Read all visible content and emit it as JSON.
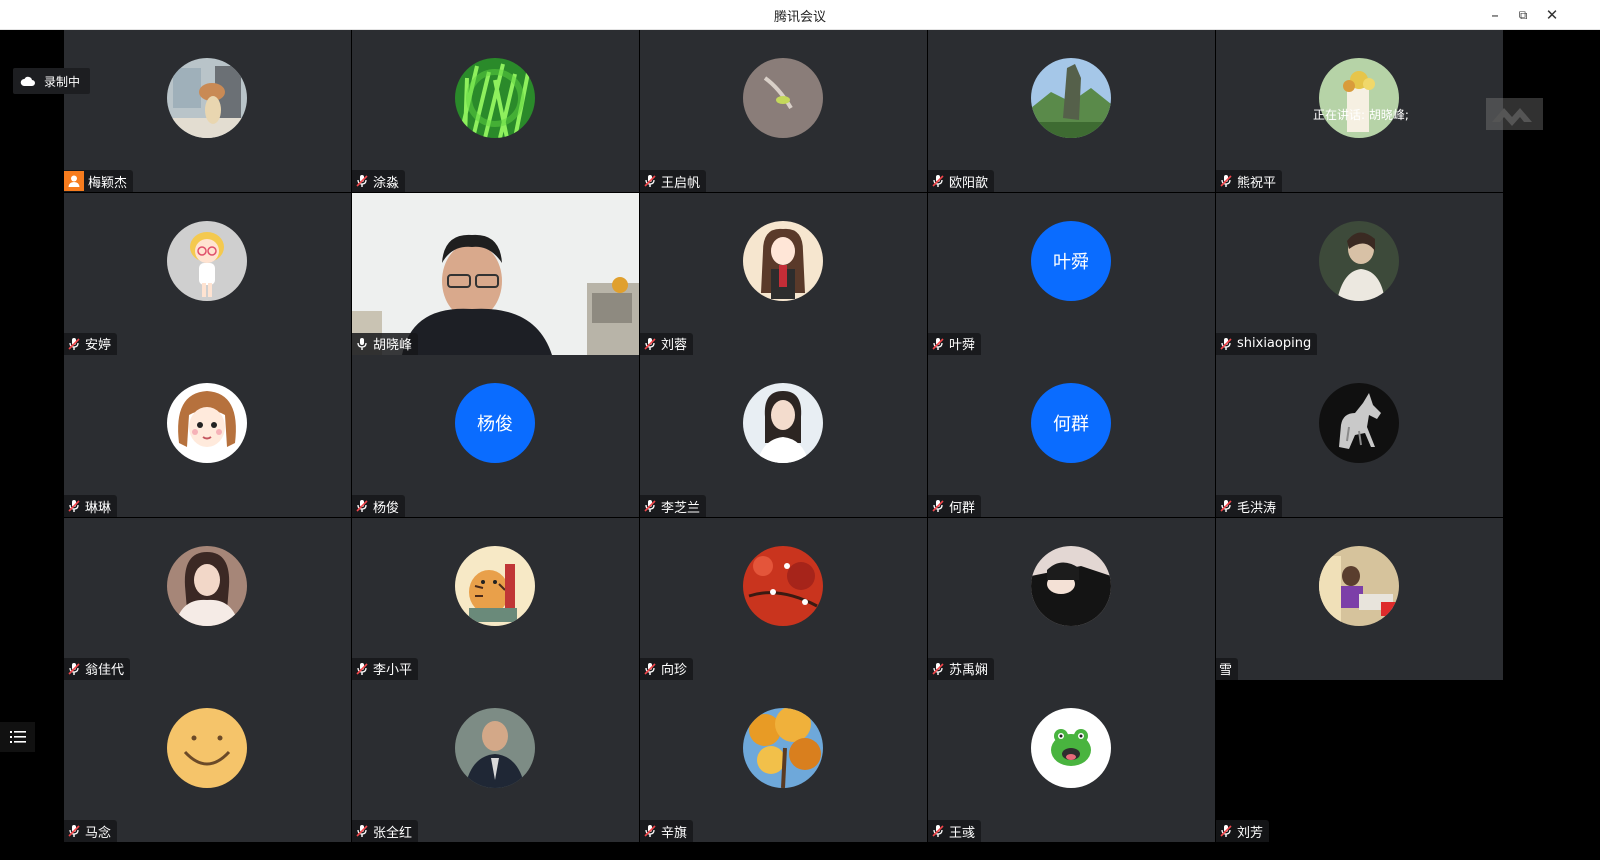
{
  "window": {
    "title": "腾讯会议"
  },
  "recording": {
    "label": "录制中"
  },
  "speaking": {
    "label": "正在讲话: 胡晓峰;"
  },
  "colors": {
    "tile_bg": "#2b2d31",
    "text_avatar": "#0a6cff",
    "host_badge": "#f77c1e",
    "active_border": "#2fd27d"
  },
  "participants": [
    {
      "name": "梅颖杰",
      "avatar": "photo-room-hat",
      "host": true
    },
    {
      "name": "涂淼",
      "avatar": "photo-green-grass"
    },
    {
      "name": "王启帆",
      "avatar": "photo-sprout"
    },
    {
      "name": "欧阳歆",
      "avatar": "photo-mountain"
    },
    {
      "name": "熊祝平",
      "avatar": "photo-flowers"
    },
    {
      "name": "安婷",
      "avatar": "cartoon-girl"
    },
    {
      "name": "胡晓峰",
      "avatar": "live-video",
      "video": true,
      "speaking": true
    },
    {
      "name": "刘蓉",
      "avatar": "illustration-girl"
    },
    {
      "name": "叶舜",
      "avatar_text": "叶舜"
    },
    {
      "name": "shixiaoping",
      "avatar": "photo-portrait"
    },
    {
      "name": "琳琳",
      "avatar": "cartoon-girl-face"
    },
    {
      "name": "杨俊",
      "avatar_text": "杨俊"
    },
    {
      "name": "李芝兰",
      "avatar": "photo-woman"
    },
    {
      "name": "何群",
      "avatar_text": "何群"
    },
    {
      "name": "毛洪涛",
      "avatar": "photo-horse"
    },
    {
      "name": "翁佳代",
      "avatar": "photo-woman-fur"
    },
    {
      "name": "李小平",
      "avatar": "illustration-tiger"
    },
    {
      "name": "向珍",
      "avatar": "photo-red-leaves"
    },
    {
      "name": "苏禹娴",
      "avatar": "photo-woman-dark"
    },
    {
      "name": "雪",
      "avatar": "photo-studio",
      "no_mic": true
    },
    {
      "name": "马念",
      "avatar": "smiley"
    },
    {
      "name": "张全红",
      "avatar": "photo-man"
    },
    {
      "name": "辛旗",
      "avatar": "photo-autumn-tree"
    },
    {
      "name": "王彧",
      "avatar": "frog"
    },
    {
      "name": "刘芳",
      "empty": true
    }
  ]
}
